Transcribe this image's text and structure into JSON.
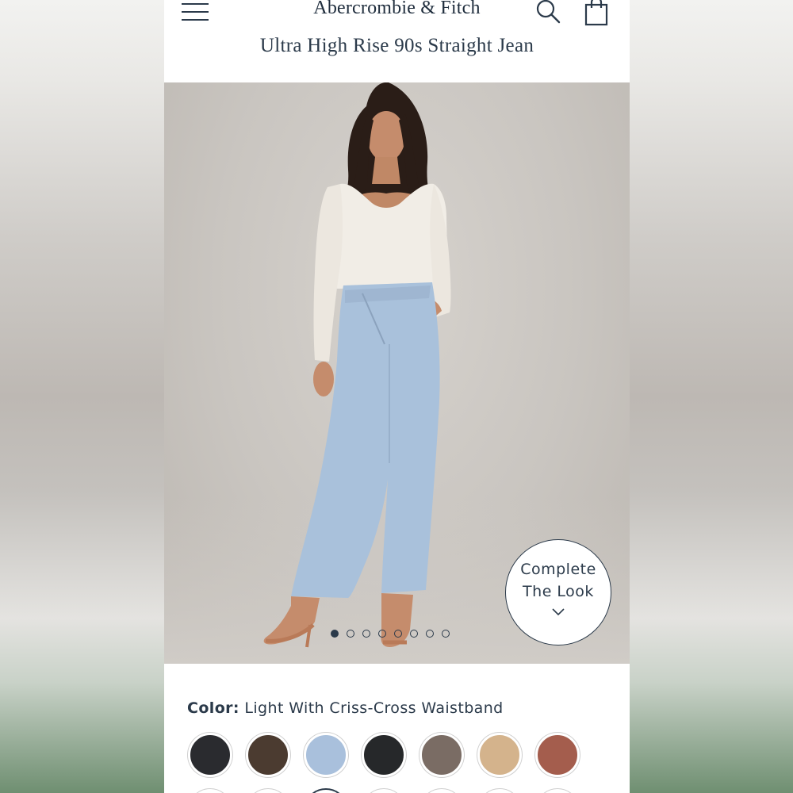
{
  "header": {
    "brand": "Abercrombie & Fitch",
    "product_title": "Ultra High Rise 90s Straight Jean"
  },
  "hero": {
    "slide_count": 8,
    "active_slide": 1,
    "complete_look_line1": "Complete",
    "complete_look_line2": "The Look"
  },
  "color": {
    "label": "Color:",
    "value": "Light With Criss-Cross Waistband"
  },
  "swatches": [
    {
      "name": "black",
      "color": "#2a2b2f"
    },
    {
      "name": "brown",
      "color": "#4b3b30"
    },
    {
      "name": "light-denim",
      "color": "#a9c0dc"
    },
    {
      "name": "black-2",
      "color": "#26282a"
    },
    {
      "name": "taupe",
      "color": "#7a6c64"
    },
    {
      "name": "tan",
      "color": "#d4b38c"
    },
    {
      "name": "rust",
      "color": "#a45d4d"
    }
  ],
  "colors": {
    "ink": "#2b3a4a",
    "denim": "#a9c1db",
    "top": "#f1ede6"
  },
  "icons": [
    "hamburger-menu-icon",
    "search-icon",
    "shopping-bag-icon",
    "chevron-down-icon"
  ]
}
